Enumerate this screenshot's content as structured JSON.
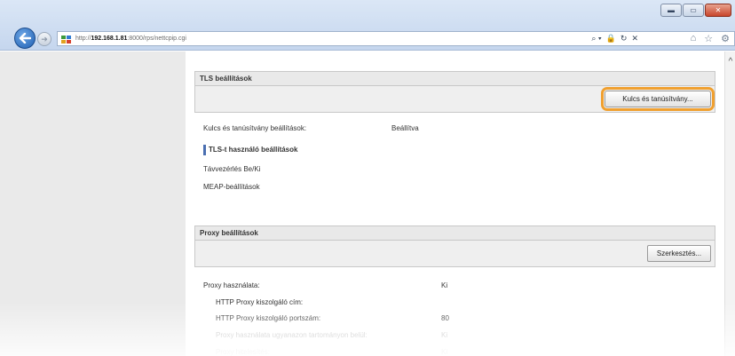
{
  "browser": {
    "url_prefix": "http://",
    "url_host": "192.168.1.81",
    "url_path": ":8000/rps/nettcpip.cgi",
    "address_tools": [
      "⌕ ▾",
      "🔒",
      "↻",
      "✕"
    ],
    "window_buttons": [
      "▬",
      "▭",
      "✕"
    ]
  },
  "tls": {
    "title": "TLS beállítások",
    "button": "Kulcs és tanúsítvány...",
    "key_cert_label": "Kulcs és tanúsítvány beállítások:",
    "key_cert_value": "Beállítva",
    "subsection": "TLS-t használó beállítások",
    "links": [
      "Távvezérlés Be/Ki",
      "MEAP-beállítások"
    ]
  },
  "proxy": {
    "title": "Proxy beállítások",
    "button": "Szerkesztés...",
    "rows": [
      {
        "label": "Proxy használata:",
        "value": "Ki"
      },
      {
        "label": "HTTP Proxy kiszolgáló cím:",
        "value": ""
      },
      {
        "label": "HTTP Proxy kiszolgáló portszám:",
        "value": "80"
      },
      {
        "label": "Proxy használata ugyanazon tartományon belül:",
        "value": "Ki"
      },
      {
        "label": "Proxy hitelesítés:",
        "value": "Ki"
      }
    ]
  }
}
